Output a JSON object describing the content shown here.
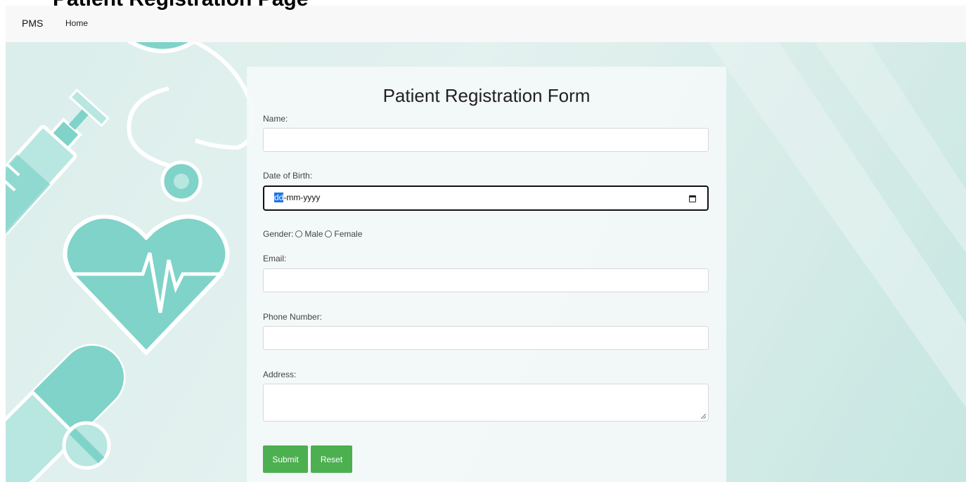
{
  "page": {
    "heading": "Patient Registration Page"
  },
  "navbar": {
    "brand": "PMS",
    "links": [
      "Home"
    ]
  },
  "form": {
    "title": "Patient Registration Form",
    "name_label": "Name:",
    "name_value": "",
    "dob_label": "Date of Birth:",
    "dob_placeholder_selected": "dd",
    "dob_placeholder_rest": "-mm-yyyy",
    "gender_label": "Gender:",
    "gender_options": [
      "Male",
      "Female"
    ],
    "email_label": "Email:",
    "email_value": "",
    "phone_label": "Phone Number:",
    "phone_value": "",
    "address_label": "Address:",
    "address_value": "",
    "submit_label": "Submit",
    "reset_label": "Reset"
  },
  "colors": {
    "button": "#4caf50",
    "accent": "#7fd3c9",
    "background": "#dbeeeb"
  },
  "icons": [
    "calendar-icon",
    "syringe-icon",
    "stethoscope-icon",
    "heart-pulse-icon",
    "pill-icon"
  ]
}
